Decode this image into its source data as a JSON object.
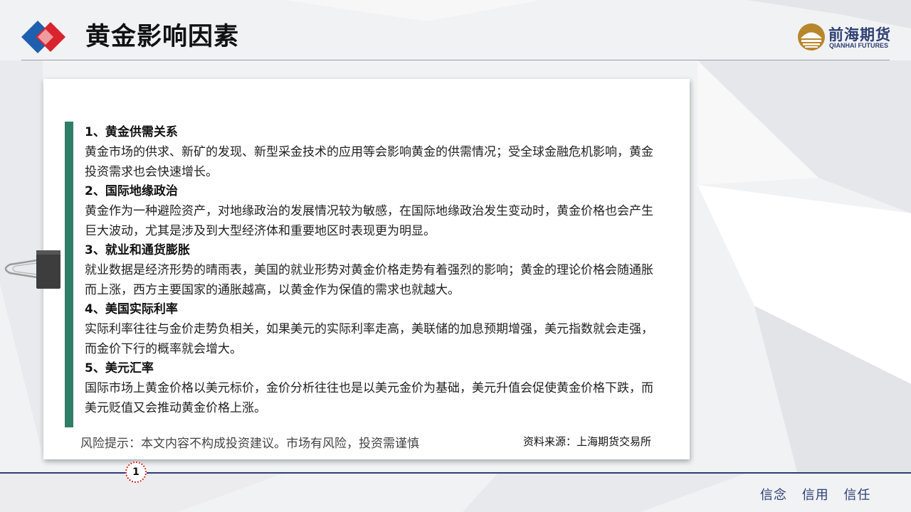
{
  "header": {
    "title": "黄金影响因素",
    "brand_name": "前海期货",
    "brand_sub": "QIANHAI FUTURES"
  },
  "sections": [
    {
      "heading": "1、黄金供需关系",
      "body": "黄金市场的供求、新矿的发现、新型采金技术的应用等会影响黄金的供需情况；受全球金融危机影响，黄金投资需求也会快速增长。"
    },
    {
      "heading": "2、国际地缘政治",
      "body": "黄金作为一种避险资产，对地缘政治的发展情况较为敏感，在国际地缘政治发生变动时，黄金价格也会产生巨大波动，尤其是涉及到大型经济体和重要地区时表现更为明显。"
    },
    {
      "heading": "3、就业和通货膨胀",
      "body": "就业数据是经济形势的晴雨表，美国的就业形势对黄金价格走势有着强烈的影响；黄金的理论价格会随通胀而上涨，西方主要国家的通胀越高，以黄金作为保值的需求也就越大。"
    },
    {
      "heading": "4、美国实际利率",
      "body": "实际利率往往与金价走势负相关，如果美元的实际利率走高，美联储的加息预期增强，美元指数就会走强，而金价下行的概率就会增大。"
    },
    {
      "heading": "5、美元汇率",
      "body": "国际市场上黄金价格以美元标价，金价分析往往也是以美元金价为基础，美元升值会促使黄金价格下跌，而美元贬值又会推动黄金价格上涨。"
    }
  ],
  "footer_notes": {
    "risk": "风险提示：本文内容不构成投资建议。市场有风险，投资需谨慎",
    "source": "资料来源：上海期货交易所"
  },
  "page_number": "1",
  "slogan": [
    "信念",
    "信用",
    "信任"
  ],
  "colors": {
    "accent_green": "#2f7e67",
    "navy": "#2d3f73",
    "logo_red": "#d9232d",
    "logo_blue": "#1f5fb0",
    "brand_gold": "#b8862b"
  },
  "icons": [
    "company-logo-diamond-icon",
    "qianhai-futures-logo-icon",
    "binder-clip-icon"
  ]
}
